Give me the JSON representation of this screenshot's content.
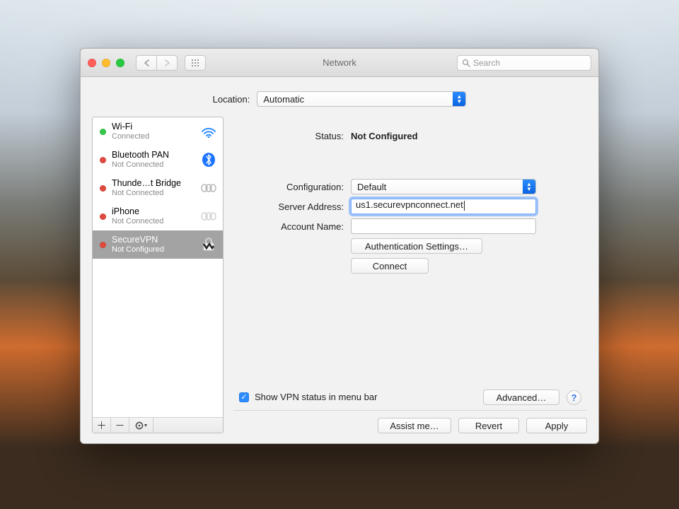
{
  "window": {
    "title": "Network"
  },
  "toolbar": {
    "search_placeholder": "Search"
  },
  "location": {
    "label": "Location:",
    "value": "Automatic"
  },
  "sidebar": {
    "items": [
      {
        "name": "Wi-Fi",
        "sub": "Connected",
        "status": "green",
        "icon": "wifi"
      },
      {
        "name": "Bluetooth PAN",
        "sub": "Not Connected",
        "status": "red",
        "icon": "bluetooth"
      },
      {
        "name": "Thunde…t Bridge",
        "sub": "Not Connected",
        "status": "red",
        "icon": "chain"
      },
      {
        "name": "iPhone",
        "sub": "Not Connected",
        "status": "red",
        "icon": "chain-dim"
      },
      {
        "name": "SecureVPN",
        "sub": "Not Configured",
        "status": "red",
        "icon": "vpn",
        "selected": true
      }
    ]
  },
  "detail": {
    "status_label": "Status:",
    "status_value": "Not Configured",
    "config_label": "Configuration:",
    "config_value": "Default",
    "server_label": "Server Address:",
    "server_value": "us1.securevpnconnect.net",
    "account_label": "Account Name:",
    "account_value": "",
    "auth_btn": "Authentication Settings…",
    "connect_btn": "Connect",
    "show_vpn_label": "Show VPN status in menu bar",
    "advanced_btn": "Advanced…"
  },
  "footer": {
    "assist": "Assist me…",
    "revert": "Revert",
    "apply": "Apply"
  }
}
